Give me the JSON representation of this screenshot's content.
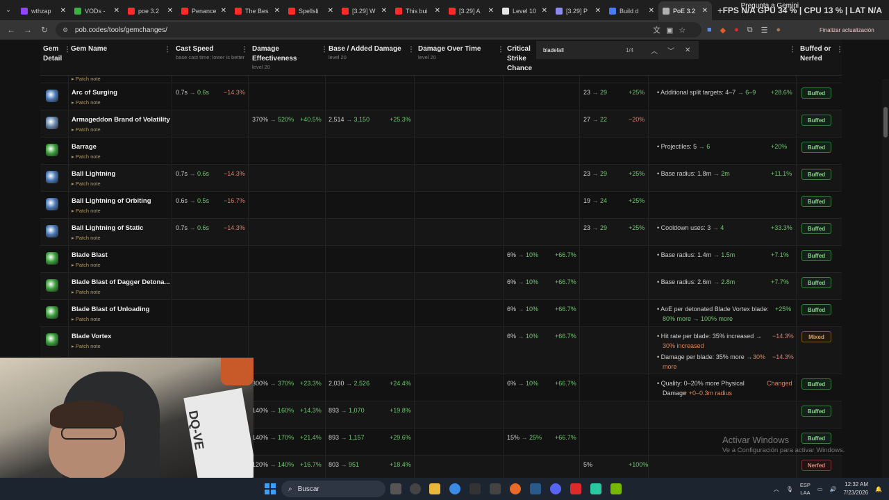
{
  "browser": {
    "tabs": [
      {
        "label": "wthzap",
        "color": "#9146ff"
      },
      {
        "label": "VODs -",
        "color": "#3cb043"
      },
      {
        "label": "poe 3.2",
        "color": "#ff2a2a"
      },
      {
        "label": "Penance",
        "color": "#ff2a2a"
      },
      {
        "label": "The Bes",
        "color": "#ff2a2a"
      },
      {
        "label": "Spellsli",
        "color": "#ff2a2a"
      },
      {
        "label": "[3.29] W",
        "color": "#ff2a2a"
      },
      {
        "label": "This bui",
        "color": "#ff2a2a"
      },
      {
        "label": "[3.29] A",
        "color": "#ff2a2a"
      },
      {
        "label": "Level 10",
        "color": "#e6e6e6"
      },
      {
        "label": "[3.29] P",
        "color": "#8a8af0"
      },
      {
        "label": "Build d",
        "color": "#4a7cf0"
      },
      {
        "label": "PoE 3.2",
        "color": "#b0b0b0"
      }
    ],
    "active_tab_index": 12,
    "overlay_text": "FPS N/A GPU 34 % | CPU 13 % | LAT N/A",
    "overlay_small": "Pregunta a Gemini",
    "url": "pob.codes/tools/gemchanges/",
    "update_button": "Finalizar actualización"
  },
  "find": {
    "query": "bladefall",
    "count": "1/4"
  },
  "table": {
    "headers": {
      "gem_detail": "Gem Detail",
      "gem_name": "Gem Name",
      "cast_speed": "Cast Speed",
      "cast_speed_sub": "base cast time; lower is better",
      "damage_eff": "Damage Effectiveness",
      "damage_eff_sub": "level 20",
      "base_added": "Base / Added Damage",
      "base_added_sub": "level 20",
      "dot": "Damage Over Time",
      "dot_sub": "level 20",
      "crit": "Critical Strike Chance",
      "buffed": "Buffed or Nerfed"
    },
    "patch_note_label": "▸ Patch note",
    "rows": [
      {
        "name": "Arc of Surging",
        "icon": "#4a7ab8",
        "cast": [
          "0.7s",
          "0.6s",
          "−14.3%"
        ],
        "mana": [
          "23",
          "29",
          "+25%"
        ],
        "other": [
          "• Additional split targets: 4–7",
          "6–9",
          "+28.6%"
        ],
        "status": "Buffed"
      },
      {
        "name": "Armageddon Brand of Volatility",
        "icon": "#6a8ab0",
        "eff": [
          "370%",
          "520%",
          "+40.5%"
        ],
        "base": [
          "2,514",
          "3,150",
          "+25.3%"
        ],
        "mana": [
          "27",
          "22",
          "−20%"
        ],
        "status": "Buffed"
      },
      {
        "name": "Barrage",
        "icon": "#3aa03a",
        "other": [
          "• Projectiles: 5",
          "6",
          "+20%"
        ],
        "status": "Buffed"
      },
      {
        "name": "Ball Lightning",
        "icon": "#4a7ab8",
        "cast": [
          "0.7s",
          "0.6s",
          "−14.3%"
        ],
        "mana": [
          "23",
          "29",
          "+25%"
        ],
        "other": [
          "• Base radius: 1.8m",
          "2m",
          "+11.1%"
        ],
        "status": "Buffed"
      },
      {
        "name": "Ball Lightning of Orbiting",
        "icon": "#4a7ab8",
        "cast": [
          "0.6s",
          "0.5s",
          "−16.7%"
        ],
        "mana": [
          "19",
          "24",
          "+25%"
        ],
        "status": "Buffed"
      },
      {
        "name": "Ball Lightning of Static",
        "icon": "#4a7ab8",
        "cast": [
          "0.7s",
          "0.6s",
          "−14.3%"
        ],
        "mana": [
          "23",
          "29",
          "+25%"
        ],
        "other": [
          "• Cooldown uses: 3",
          "4",
          "+33.3%"
        ],
        "status": "Buffed"
      },
      {
        "name": "Blade Blast",
        "icon": "#3aa03a",
        "crit": [
          "6%",
          "10%",
          "+66.7%"
        ],
        "other": [
          "• Base radius: 1.4m",
          "1.5m",
          "+7.1%"
        ],
        "status": "Buffed"
      },
      {
        "name": "Blade Blast of Dagger Detona...",
        "icon": "#3aa03a",
        "crit": [
          "6%",
          "10%",
          "+66.7%"
        ],
        "other": [
          "• Base radius: 2.6m",
          "2.8m",
          "+7.7%"
        ],
        "status": "Buffed"
      },
      {
        "name": "Blade Blast of Unloading",
        "icon": "#3aa03a",
        "crit": [
          "6%",
          "10%",
          "+66.7%"
        ],
        "other": [
          "• AoE per detonated Blade Vortex blade:",
          "80% more → 100% more",
          "+25%"
        ],
        "status": "Buffed"
      },
      {
        "name": "Blade Vortex",
        "icon": "#3aa03a",
        "crit": [
          "6%",
          "10%",
          "+66.7%"
        ],
        "other": [
          "• Hit rate per blade: 35% increased →",
          "30% increased",
          "−14.3%",
          "• Damage per blade: 35% more →",
          "30%",
          "more",
          "−14.3%"
        ],
        "status": "Mixed"
      },
      {
        "name": "",
        "eff": [
          "300%",
          "370%",
          "+23.3%"
        ],
        "base": [
          "2,030",
          "2,526",
          "+24.4%"
        ],
        "crit": [
          "6%",
          "10%",
          "+66.7%"
        ],
        "other": [
          "• Quality: 0–20% more Physical",
          "Damage",
          "+ +0–0.3m radius",
          "Changed"
        ],
        "status": "Buffed"
      },
      {
        "name": "",
        "eff": [
          "140%",
          "160%",
          "+14.3%"
        ],
        "base": [
          "893",
          "1,070",
          "+19.8%"
        ],
        "status": "Buffed"
      },
      {
        "name": "",
        "eff": [
          "140%",
          "170%",
          "+21.4%"
        ],
        "base": [
          "893",
          "1,157",
          "+29.6%"
        ],
        "crit": [
          "15%",
          "25%",
          "+66.7%"
        ],
        "status": "Buffed"
      },
      {
        "name": "",
        "eff": [
          "120%",
          "140%",
          "+16.7%"
        ],
        "base": [
          "803",
          "951",
          "+18.4%"
        ],
        "mana": [
          "5%",
          "",
          "+100%"
        ],
        "status": "Nerfed"
      }
    ]
  },
  "webcam": {
    "box_text": "DQ-VE"
  },
  "watermark": {
    "title": "Activar Windows",
    "subtitle": "Ve a Configuración para activar Windows."
  },
  "taskbar": {
    "search_placeholder": "Buscar",
    "lang_top": "ESP",
    "lang_bottom": "LAA",
    "time": "12:32 AM",
    "date": "7/23/2026"
  }
}
